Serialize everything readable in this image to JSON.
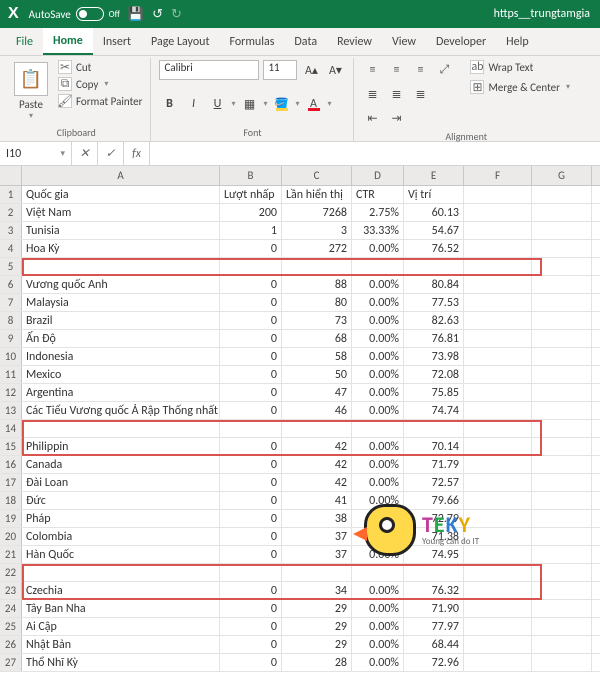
{
  "titlebar": {
    "autosave": "AutoSave",
    "autosave_state": "Off",
    "docname": "https__trungtamgia"
  },
  "tabs": [
    "File",
    "Home",
    "Insert",
    "Page Layout",
    "Formulas",
    "Data",
    "Review",
    "View",
    "Developer",
    "Help"
  ],
  "active_tab": 1,
  "clipboard": {
    "paste": "Paste",
    "cut": "Cut",
    "copy": "Copy",
    "format_painter": "Format Painter",
    "label": "Clipboard"
  },
  "font": {
    "name": "Calibri",
    "size": "11",
    "label": "Font"
  },
  "alignment": {
    "wrap": "Wrap Text",
    "merge": "Merge & Center",
    "label": "Alignment"
  },
  "namebox": "I10",
  "cols": [
    "A",
    "B",
    "C",
    "D",
    "E",
    "F",
    "G"
  ],
  "headers": {
    "A": "Quốc gia",
    "B": "Lượt nhấp",
    "C": "Lần hiển thị",
    "D": "CTR",
    "E": "Vị trí"
  },
  "rows": [
    {
      "n": 1
    },
    {
      "n": 2,
      "A": "Việt Nam",
      "B": "200",
      "C": "7268",
      "D": "2.75%",
      "E": "60.13"
    },
    {
      "n": 3,
      "A": "Tunisia",
      "B": "1",
      "C": "3",
      "D": "33.33%",
      "E": "54.67"
    },
    {
      "n": 4,
      "A": "Hoa Kỳ",
      "B": "0",
      "C": "272",
      "D": "0.00%",
      "E": "76.52"
    },
    {
      "n": 5
    },
    {
      "n": 6,
      "A": "Vương quốc Anh",
      "B": "0",
      "C": "88",
      "D": "0.00%",
      "E": "80.84"
    },
    {
      "n": 7,
      "A": "Malaysia",
      "B": "0",
      "C": "80",
      "D": "0.00%",
      "E": "77.53"
    },
    {
      "n": 8,
      "A": "Brazil",
      "B": "0",
      "C": "73",
      "D": "0.00%",
      "E": "82.63"
    },
    {
      "n": 9,
      "A": "Ấn Độ",
      "B": "0",
      "C": "68",
      "D": "0.00%",
      "E": "76.81"
    },
    {
      "n": 10,
      "A": "Indonesia",
      "B": "0",
      "C": "58",
      "D": "0.00%",
      "E": "73.98"
    },
    {
      "n": 11,
      "A": "Mexico",
      "B": "0",
      "C": "50",
      "D": "0.00%",
      "E": "72.08"
    },
    {
      "n": 12,
      "A": "Argentina",
      "B": "0",
      "C": "47",
      "D": "0.00%",
      "E": "75.85"
    },
    {
      "n": 13,
      "A": "Các Tiểu Vương quốc Ả Rập Thống nhất",
      "B": "0",
      "C": "46",
      "D": "0.00%",
      "E": "74.74"
    },
    {
      "n": 14
    },
    {
      "n": 15,
      "A": "Philippin",
      "B": "0",
      "C": "42",
      "D": "0.00%",
      "E": "70.14"
    },
    {
      "n": 16,
      "A": "Canada",
      "B": "0",
      "C": "42",
      "D": "0.00%",
      "E": "71.79"
    },
    {
      "n": 17,
      "A": "Đài Loan",
      "B": "0",
      "C": "42",
      "D": "0.00%",
      "E": "72.57"
    },
    {
      "n": 18,
      "A": "Đức",
      "B": "0",
      "C": "41",
      "D": "0.00%",
      "E": "79.66"
    },
    {
      "n": 19,
      "A": "Pháp",
      "B": "0",
      "C": "38",
      "D": "0.00%",
      "E": "72.79"
    },
    {
      "n": 20,
      "A": "Colombia",
      "B": "0",
      "C": "37",
      "D": "0.00%",
      "E": "71.38"
    },
    {
      "n": 21,
      "A": "Hàn Quốc",
      "B": "0",
      "C": "37",
      "D": "0.00%",
      "E": "74.95"
    },
    {
      "n": 22
    },
    {
      "n": 23,
      "A": "Czechia",
      "B": "0",
      "C": "34",
      "D": "0.00%",
      "E": "76.32"
    },
    {
      "n": 24,
      "A": "Tây Ban Nha",
      "B": "0",
      "C": "29",
      "D": "0.00%",
      "E": "71.90"
    },
    {
      "n": 25,
      "A": "Ai Cập",
      "B": "0",
      "C": "29",
      "D": "0.00%",
      "E": "77.97"
    },
    {
      "n": 26,
      "A": "Nhật Bản",
      "B": "0",
      "C": "29",
      "D": "0.00%",
      "E": "68.44"
    },
    {
      "n": 27,
      "A": "Thổ Nhĩ Kỳ",
      "B": "0",
      "C": "28",
      "D": "0.00%",
      "E": "72.96"
    }
  ],
  "logo": {
    "brand": "TEKY",
    "tag": "Young can do IT"
  }
}
